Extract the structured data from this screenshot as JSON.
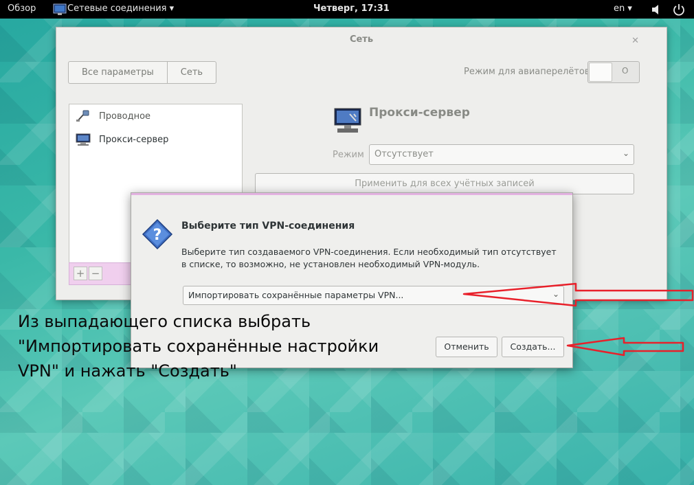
{
  "topbar": {
    "activities": "Обзор",
    "app_menu": "Сетевые соединения ▾",
    "clock": "Четверг, 17:31",
    "language": "en ▾",
    "sound_icon": "◀)",
    "power_icon": "⏻"
  },
  "window": {
    "title": "Сеть",
    "close_icon": "✕",
    "nav": {
      "all_settings": "Все параметры",
      "network": "Сеть"
    },
    "airplane_mode": {
      "label": "Режим для авиаперелётов",
      "state": "O"
    },
    "sidebar": {
      "items": [
        {
          "label": "Проводное",
          "icon": "wired-network-icon"
        },
        {
          "label": "Прокси-сервер",
          "icon": "proxy-server-icon"
        }
      ],
      "add_label": "+",
      "remove_label": "−"
    },
    "proxy_panel": {
      "title": "Прокси-сервер",
      "mode_label": "Режим",
      "mode_value": "Отсутствует",
      "apply_button": "Применить для всех учётных записей"
    }
  },
  "dialog": {
    "title": "Выберите тип VPN-соединения",
    "text_line1": "Выберите тип создаваемого VPN-соединения. Если необходимый тип отсутствует",
    "text_line2": "в списке, то возможно, не установлен необходимый VPN-модуль.",
    "vpn_type_value": "Импортировать сохранённые параметры VPN...",
    "cancel_button": "Отменить",
    "create_button": "Создать..."
  },
  "annotation": {
    "line1": "Из выпадающего списка выбрать",
    "line2": "\"Импортировать сохранённые настройки",
    "line3": "VPN\" и нажать \"Создать\"",
    "arrow_color": "#e8202a"
  }
}
